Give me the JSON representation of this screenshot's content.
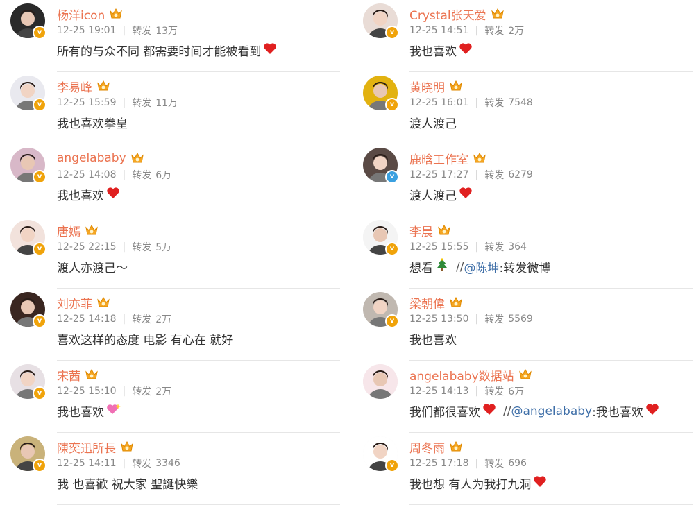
{
  "vip_icon": "crown-vip-icon",
  "repost_label": "转发",
  "left": [
    {
      "name": "杨洋icon",
      "time": "12-25 19:01",
      "reposts": "13万",
      "text": "所有的与众不同 都需要时间才能被看到",
      "emoji": "heart",
      "avatar": "#2a2a2a",
      "badge": "v"
    },
    {
      "name": "李易峰",
      "time": "12-25 15:59",
      "reposts": "11万",
      "text": "我也喜欢拳皇",
      "emoji": "",
      "avatar": "#e9e9ef",
      "badge": "v"
    },
    {
      "name": "angelababy",
      "time": "12-25 14:08",
      "reposts": "6万",
      "text": "我也喜欢",
      "emoji": "heart",
      "avatar": "#d8b8c8",
      "badge": "v"
    },
    {
      "name": "唐嫣",
      "time": "12-25 22:15",
      "reposts": "5万",
      "text": "渡人亦渡己～",
      "emoji": "",
      "avatar": "#f2e2dc",
      "badge": "v"
    },
    {
      "name": "刘亦菲",
      "time": "12-25 14:18",
      "reposts": "2万",
      "text": "喜欢这样的态度 电影 有心在 就好",
      "emoji": "",
      "avatar": "#3a2620",
      "badge": "v"
    },
    {
      "name": "宋茜",
      "time": "12-25 15:10",
      "reposts": "2万",
      "text": "我也喜欢",
      "emoji": "sparkle-heart",
      "avatar": "#e7e0e4",
      "badge": "v"
    },
    {
      "name": "陳奕迅所長",
      "time": "12-25 14:11",
      "reposts": "3346",
      "text": "我  也喜歡 祝大家 聖誕快樂",
      "emoji": "",
      "avatar": "#c9b27a",
      "badge": "v"
    }
  ],
  "right": [
    {
      "name": "Crystal张天爱",
      "time": "12-25 14:51",
      "reposts": "2万",
      "text": "我也喜欢",
      "emoji": "heart",
      "avatar": "#e9dcd6",
      "badge": "v"
    },
    {
      "name": "黄晓明",
      "time": "12-25 16:01",
      "reposts": "7548",
      "text": "渡人渡己",
      "emoji": "",
      "avatar": "#e2b210",
      "badge": "v"
    },
    {
      "name": "鹿晗工作室",
      "time": "12-25 17:27",
      "reposts": "6279",
      "text": "渡人渡己",
      "emoji": "heart",
      "avatar": "#5a4a45",
      "badge": "blue"
    },
    {
      "name": "李晨",
      "time": "12-25 15:55",
      "reposts": "364",
      "text": "想看",
      "emoji": "tree",
      "link": "@陈坤",
      "link_after": ":转发微博",
      "avatar": "#f4f4f4",
      "badge": "v"
    },
    {
      "name": "梁朝偉",
      "time": "12-25 13:50",
      "reposts": "5569",
      "text": "我也喜欢",
      "emoji": "",
      "avatar": "#c0b8b0",
      "badge": "v"
    },
    {
      "name": "angelababy数据站",
      "time": "12-25 14:13",
      "reposts": "6万",
      "text": "我们都很喜欢",
      "emoji": "heart",
      "link": "@angelababy",
      "link_after": ":我也喜欢",
      "link_heart": true,
      "avatar": "#f7e6ea",
      "badge": ""
    },
    {
      "name": "周冬雨",
      "time": "12-25 17:18",
      "reposts": "696",
      "text": "我也想 有人为我打九洞",
      "emoji": "heart",
      "avatar": "#ffffff",
      "badge": "v"
    }
  ]
}
